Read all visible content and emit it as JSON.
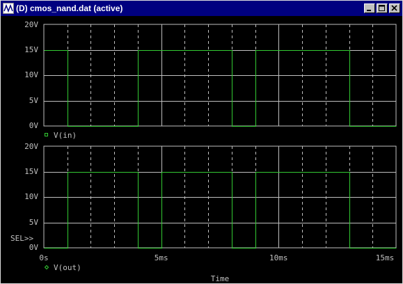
{
  "window": {
    "title": "(D) cmos_nand.dat (active)",
    "controls": [
      "minimize",
      "maximize",
      "close"
    ]
  },
  "colors": {
    "background": "#000000",
    "grid": "#c0c0c0",
    "trace": "#33cc33",
    "text": "#c0c0c0"
  },
  "plots": {
    "top": {
      "y_ticks": [
        "20V",
        "15V",
        "10V",
        "5V",
        "0V"
      ],
      "legend": "V(in)",
      "legend_marker": "square"
    },
    "bottom": {
      "y_ticks": [
        "20V",
        "15V",
        "10V",
        "5V",
        "0V"
      ],
      "sel_label": "SEL>>",
      "legend": "V(out)",
      "legend_marker": "diamond"
    },
    "x_ticks": [
      "0s",
      "5ms",
      "10ms",
      "15ms"
    ],
    "x_label": "Time"
  },
  "chart_data": [
    {
      "type": "line",
      "name": "V(in)",
      "xlim": [
        0,
        15
      ],
      "ylim": [
        0,
        20
      ],
      "x": [
        0,
        1,
        1,
        4,
        4,
        8,
        8,
        9,
        9,
        13,
        13,
        15
      ],
      "y": [
        15,
        15,
        0,
        0,
        15,
        15,
        0,
        0,
        15,
        15,
        0,
        0
      ]
    },
    {
      "type": "line",
      "name": "V(out)",
      "xlim": [
        0,
        15
      ],
      "ylim": [
        0,
        20
      ],
      "x": [
        0,
        1,
        1,
        4,
        4,
        5,
        5,
        8,
        8,
        9,
        9,
        13,
        13,
        15
      ],
      "y": [
        0,
        0,
        15,
        15,
        0,
        0,
        15,
        15,
        0,
        0,
        15,
        15,
        0,
        0
      ]
    }
  ]
}
